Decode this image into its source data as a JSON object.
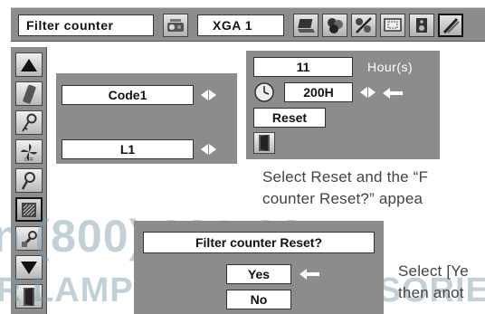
{
  "top_menu": {
    "title": "Filter counter",
    "source": "XGA 1",
    "icons": [
      "projector-icon",
      "laptop-icon",
      "color-balls-icon",
      "image-adjust-icon",
      "screen-icon",
      "speaker-icon",
      "setting-icon"
    ]
  },
  "sidebar": {
    "icons": [
      "up-arrow-icon",
      "battery-icon",
      "key-icon",
      "fan-off-icon",
      "lamp-icon",
      "filter-icon",
      "wrench-icon",
      "down-arrow-icon",
      "exit-door-icon"
    ],
    "selected": "filter-icon"
  },
  "left_panel": {
    "code_value": "Code1",
    "level_value": "L1"
  },
  "right_panel": {
    "hours_value": "11",
    "hours_unit": "Hour(s)",
    "timer_value": "200H",
    "reset_label": "Reset"
  },
  "instruction_1": {
    "line1": "Select Reset and the “F",
    "line2": "counter Reset?” appea"
  },
  "dialog": {
    "title": "Filter counter Reset?",
    "yes_label": "Yes",
    "no_label": "No"
  },
  "instruction_2": {
    "line1": "Select [Ye",
    "line2": "then anot"
  },
  "watermark": {
    "phone": "n (800) 281-88",
    "brand": "R LAMPS AND ACCESSORIE"
  },
  "colors": {
    "panel_gray": "#8c8c8c",
    "field_white": "#ffffff",
    "watermark_blue": "#7a9aaa"
  }
}
